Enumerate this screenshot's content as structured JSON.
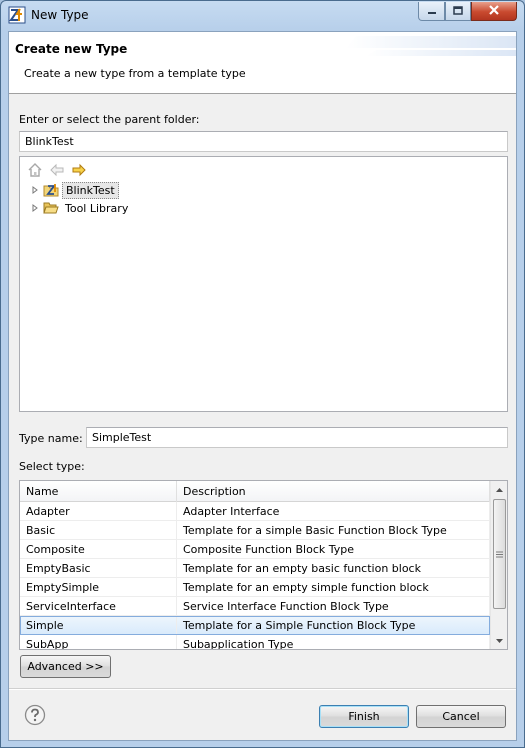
{
  "window": {
    "title": "New Type"
  },
  "header": {
    "title": "Create new Type",
    "description": "Create a new type from a template type"
  },
  "parent_folder": {
    "label": "Enter or select the parent folder:",
    "value": "BlinkTest"
  },
  "tree": {
    "items": [
      {
        "label": "BlinkTest",
        "icon": "project-icon",
        "selected": true
      },
      {
        "label": "Tool Library",
        "icon": "folder-open-icon",
        "selected": false
      }
    ]
  },
  "type_name": {
    "label": "Type name:",
    "value": "SimpleTest"
  },
  "select_type": {
    "label": "Select type:",
    "columns": [
      "Name",
      "Description"
    ],
    "rows": [
      {
        "name": "Adapter",
        "description": "Adapter Interface"
      },
      {
        "name": "Basic",
        "description": "Template for a simple Basic Function Block Type"
      },
      {
        "name": "Composite",
        "description": "Composite Function Block Type"
      },
      {
        "name": "EmptyBasic",
        "description": "Template for an empty basic function block"
      },
      {
        "name": "EmptySimple",
        "description": "Template for an empty simple function block"
      },
      {
        "name": "ServiceInterface",
        "description": "Service Interface Function Block Type"
      },
      {
        "name": "Simple",
        "description": "Template for a Simple Function Block Type"
      },
      {
        "name": "SubApp",
        "description": "Subapplication Type"
      }
    ],
    "selected_row": 6
  },
  "buttons": {
    "advanced": "Advanced >>",
    "finish": "Finish",
    "cancel": "Cancel"
  },
  "colors": {
    "selection": "#d8eafb",
    "title_bar": "#b7cfea",
    "close_button": "#c94a2f"
  }
}
